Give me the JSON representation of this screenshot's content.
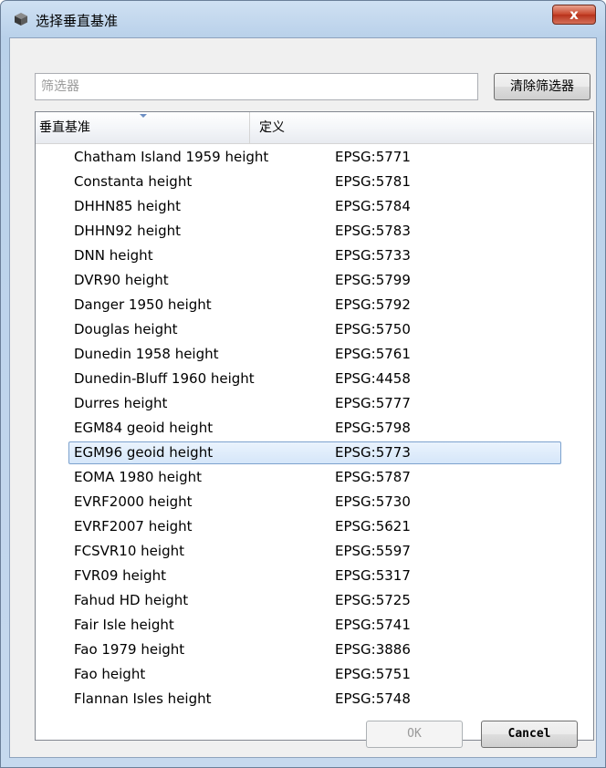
{
  "window": {
    "title": "选择垂直基准",
    "close_label": "x",
    "icon": "cube-app-icon"
  },
  "filter": {
    "placeholder": "筛选器",
    "value": "",
    "clear_label": "清除筛选器"
  },
  "table": {
    "columns": [
      "垂直基准",
      "定义"
    ],
    "rows": [
      {
        "name": "Chatham Island 1959 height",
        "def": "EPSG:5771"
      },
      {
        "name": "Constanta height",
        "def": "EPSG:5781"
      },
      {
        "name": "DHHN85 height",
        "def": "EPSG:5784"
      },
      {
        "name": "DHHN92 height",
        "def": "EPSG:5783"
      },
      {
        "name": "DNN height",
        "def": "EPSG:5733"
      },
      {
        "name": "DVR90 height",
        "def": "EPSG:5799"
      },
      {
        "name": "Danger 1950 height",
        "def": "EPSG:5792"
      },
      {
        "name": "Douglas height",
        "def": "EPSG:5750"
      },
      {
        "name": "Dunedin 1958 height",
        "def": "EPSG:5761"
      },
      {
        "name": "Dunedin-Bluff 1960 height",
        "def": "EPSG:4458"
      },
      {
        "name": "Durres height",
        "def": "EPSG:5777"
      },
      {
        "name": "EGM84 geoid height",
        "def": "EPSG:5798"
      },
      {
        "name": "EGM96 geoid height",
        "def": "EPSG:5773"
      },
      {
        "name": "EOMA 1980 height",
        "def": "EPSG:5787"
      },
      {
        "name": "EVRF2000 height",
        "def": "EPSG:5730"
      },
      {
        "name": "EVRF2007 height",
        "def": "EPSG:5621"
      },
      {
        "name": "FCSVR10 height",
        "def": "EPSG:5597"
      },
      {
        "name": "FVR09 height",
        "def": "EPSG:5317"
      },
      {
        "name": "Fahud HD height",
        "def": "EPSG:5725"
      },
      {
        "name": "Fair Isle height",
        "def": "EPSG:5741"
      },
      {
        "name": "Fao 1979 height",
        "def": "EPSG:3886"
      },
      {
        "name": "Fao height",
        "def": "EPSG:5751"
      },
      {
        "name": "Flannan Isles height",
        "def": "EPSG:5748"
      }
    ],
    "selected_name": "EGM96 geoid height"
  },
  "buttons": {
    "ok_label": "OK",
    "cancel_label": "Cancel"
  },
  "colors": {
    "selection_border": "#7da2ce",
    "close_button": "#c7442a"
  }
}
